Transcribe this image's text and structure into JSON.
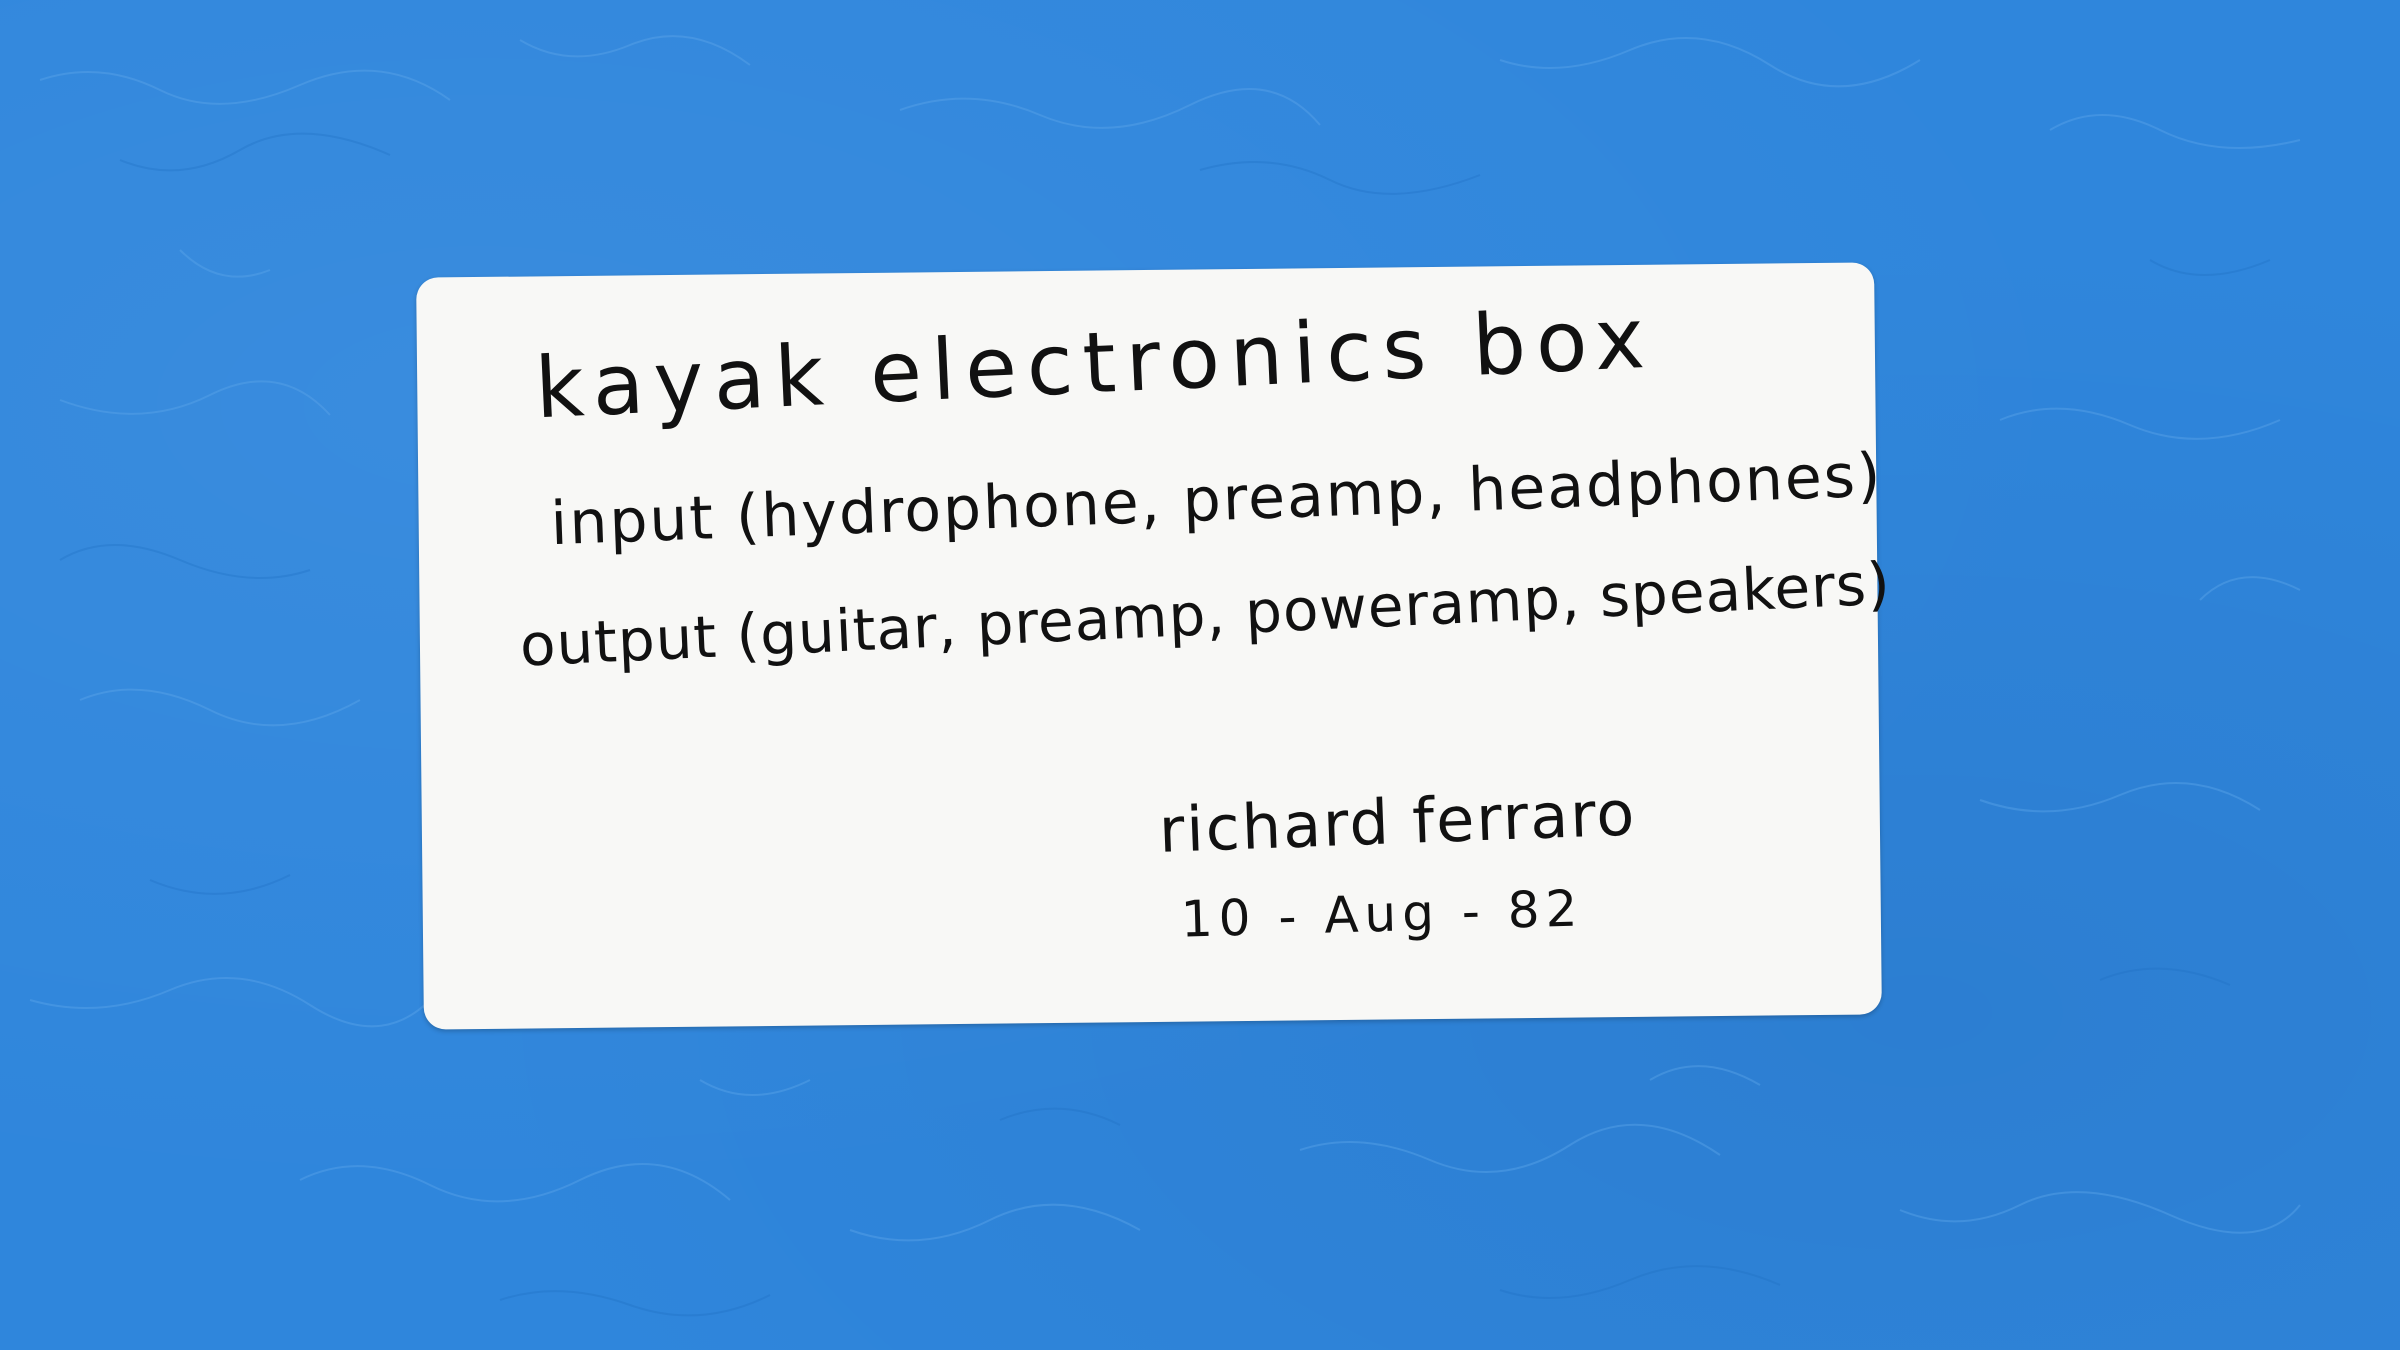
{
  "scene": {
    "background": "blue textured cover",
    "background_color": "#2f86dc",
    "label_color": "#f8f8f6",
    "ink_color": "#111111"
  },
  "label": {
    "title": "kayak electronics box",
    "input_line": "input (hydrophone, preamp, headphones)",
    "output_line": "output (guitar, preamp, poweramp, speakers)",
    "signature": "richard ferraro",
    "date": "10 - Aug - 82"
  }
}
